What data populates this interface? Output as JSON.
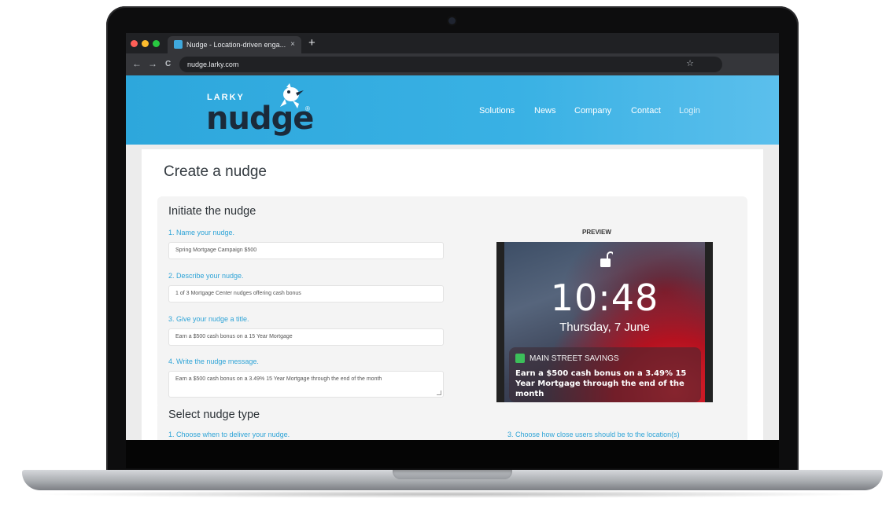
{
  "browser": {
    "tab_title": "Nudge - Location-driven enga...",
    "tab_close": "×",
    "new_tab": "+",
    "url": "nudge.larky.com",
    "back": "←",
    "forward": "→",
    "reload": "C",
    "bookmark": "☆"
  },
  "site": {
    "logo_small": "LARKY",
    "logo_big": "nudge",
    "logo_mark": "®",
    "nav": [
      "Solutions",
      "News",
      "Company",
      "Contact",
      "Login"
    ]
  },
  "page": {
    "title": "Create a nudge",
    "section1_title": "Initiate the nudge",
    "fields": [
      {
        "label": "1. Name your nudge.",
        "value": "Spring Mortgage Campaign $500"
      },
      {
        "label": "2. Describe your nudge.",
        "value": "1 of 3 Mortgage Center nudges offering cash bonus"
      },
      {
        "label": "3. Give your nudge a title.",
        "value": "Earn a $500 cash bonus on a 15 Year Mortgage"
      },
      {
        "label": "4. Write the nudge message.",
        "value": "Earn a $500 cash bonus on a 3.49% 15 Year Mortgage through the end of the month"
      }
    ],
    "section2_title": "Select nudge type",
    "section2_label_left": "1. Choose when to deliver your nudge.",
    "section2_label_right": "3. Choose how close users should be to the location(s)"
  },
  "preview": {
    "label": "PREVIEW",
    "time": "10:48",
    "date": "Thursday, 7 June",
    "notification_app": "MAIN STREET SAVINGS",
    "notification_body": "Earn a $500 cash bonus on a 3.49% 15 Year Mortgage through the end of the month"
  },
  "colors": {
    "brand_blue": "#2da7dc",
    "label_blue": "#2fa4d7",
    "dark_text": "#1b2a3a"
  }
}
